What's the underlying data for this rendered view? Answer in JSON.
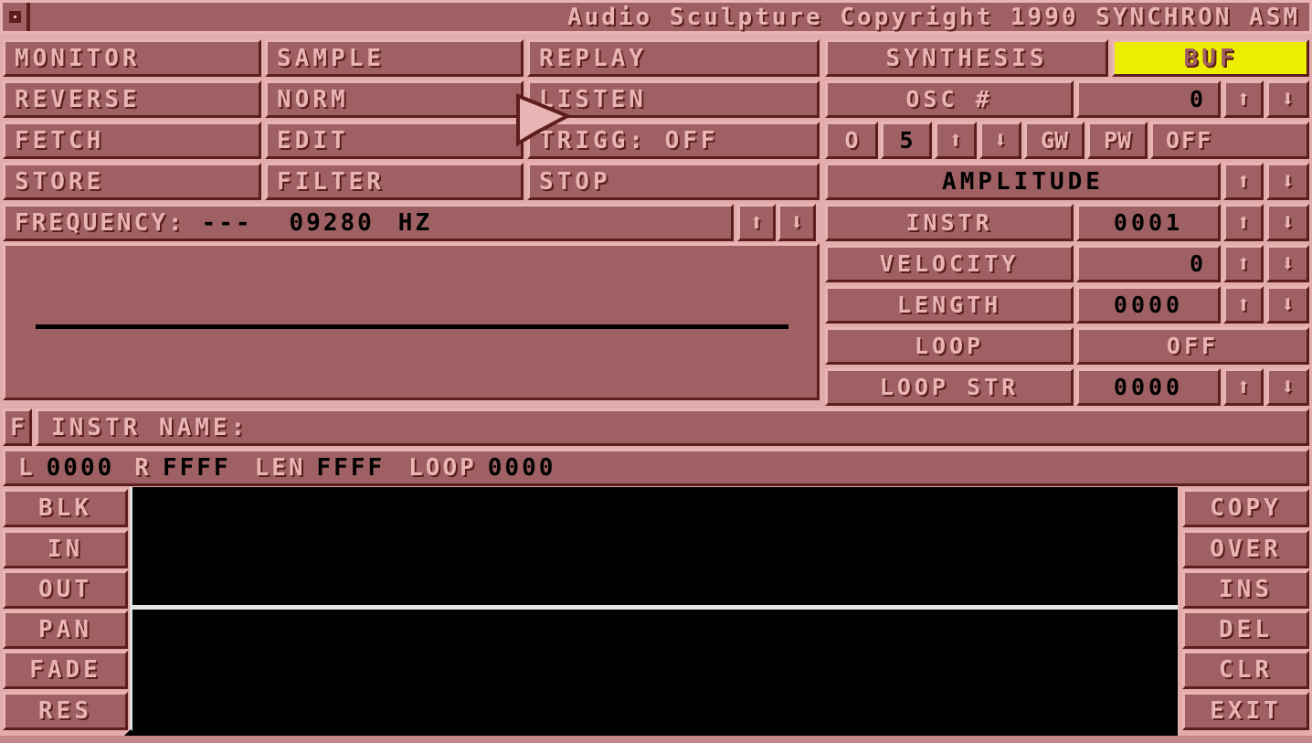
{
  "window": {
    "title": "Audio Sculpture  Copyright 1990 SYNCHRON ASM",
    "close_icon": "close-box-icon"
  },
  "toolbar": {
    "column1": [
      "MONITOR",
      "REVERSE",
      "FETCH",
      "STORE"
    ],
    "column2": [
      "SAMPLE",
      "NORM",
      "EDIT",
      "FILTER"
    ],
    "column3": [
      "REPLAY",
      "LISTEN",
      "TRIGG: OFF",
      "STOP"
    ]
  },
  "frequency": {
    "label": "FREQUENCY:",
    "dashes": "---",
    "value": "09280",
    "unit": "HZ",
    "up_icon": "arrow-up-icon",
    "down_icon": "arrow-down-icon"
  },
  "synthesis": {
    "title": "SYNTHESIS",
    "buffer_label": "BUF",
    "buffer_highlight_color": "#eded00",
    "osc_label": "OSC  #",
    "osc_value": "0",
    "wave_o": "O",
    "wave_num": "5",
    "gw_label": "GW",
    "pw_label": "PW",
    "pw_value": "OFF",
    "amplitude_label": "AMPLITUDE"
  },
  "instrument": {
    "instr_label": "INSTR",
    "instr_value": "0001",
    "velocity_label": "VELOCITY",
    "velocity_value": "0",
    "length_label": "LENGTH",
    "length_value": "0000",
    "loop_label": "LOOP",
    "loop_value": "OFF",
    "loop_str_label": "LOOP  STR",
    "loop_str_value": "0000"
  },
  "name_row": {
    "f_button": "F",
    "instr_name_label": "INSTR  NAME:",
    "instr_name_value": ""
  },
  "range_row": {
    "l_label": "L",
    "l_value": "0000",
    "r_label": "R",
    "r_value": "FFFF",
    "len_label": "LEN",
    "len_value": "FFFF",
    "loop_label": "LOOP",
    "loop_value": "0000"
  },
  "left_buttons": [
    "BLK",
    "IN",
    "OUT",
    "PAN",
    "FADE",
    "RES"
  ],
  "right_buttons": [
    "COPY",
    "OVER",
    "INS",
    "DEL",
    "CLR",
    "EXIT"
  ],
  "icons": {
    "up": "⬆",
    "down": "⬇",
    "cursor": "mouse-pointer-icon"
  },
  "colors": {
    "panel": "#9e6062",
    "light_bevel": "#e8b4b4",
    "dark_bevel": "#5c1d1d",
    "page_bg": "#e2acac",
    "highlight": "#eded00",
    "black": "#000000",
    "divider": "#e4e4e4"
  }
}
